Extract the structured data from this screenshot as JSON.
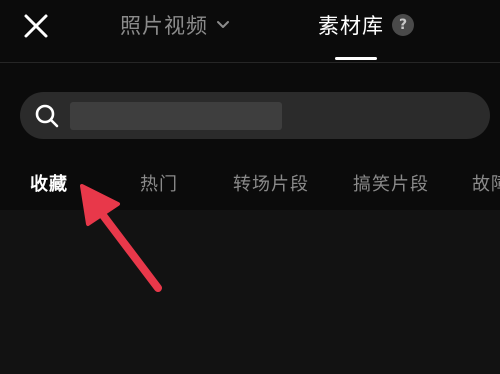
{
  "header": {
    "close_icon": "close-icon",
    "tabs": [
      {
        "label": "照片视频",
        "has_dropdown": true,
        "active": false
      },
      {
        "label": "素材库",
        "has_help": true,
        "active": true
      }
    ],
    "help_symbol": "?"
  },
  "search": {
    "icon": "search-icon",
    "value": ""
  },
  "categories": [
    {
      "label": "收藏",
      "active": true
    },
    {
      "label": "热门",
      "active": false
    },
    {
      "label": "转场片段",
      "active": false
    },
    {
      "label": "搞笑片段",
      "active": false
    },
    {
      "label": "故障",
      "active": false
    }
  ],
  "annotation": {
    "type": "arrow",
    "color": "#e8384a",
    "points_to": "收藏"
  },
  "colors": {
    "background": "#0b0b0b",
    "search_bg": "#2b2b2b",
    "active_text": "#ffffff",
    "inactive_text": "#8a8a8a",
    "annotation": "#e8384a"
  }
}
